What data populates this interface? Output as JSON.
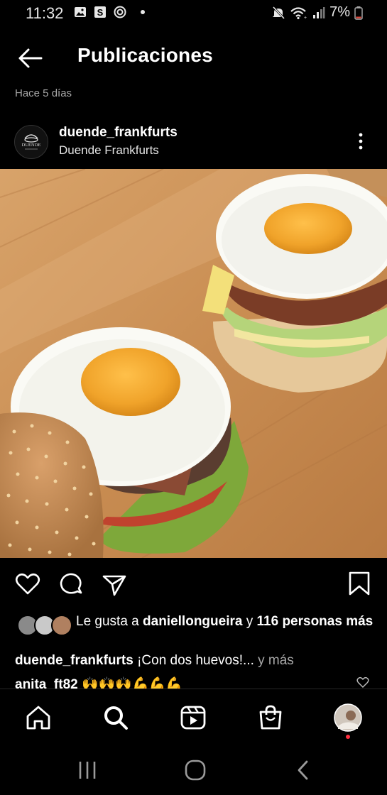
{
  "status_bar": {
    "time": "11:32",
    "battery": "7%",
    "left_icons": [
      "image-icon",
      "s-app-icon",
      "vpn-icon",
      "dot-icon"
    ],
    "right_icons": [
      "mute-icon",
      "wifi-icon",
      "signal-icon",
      "battery-icon"
    ]
  },
  "header": {
    "title": "Publicaciones",
    "back_icon": "arrow-left-icon"
  },
  "post": {
    "age": "Hace 5 días",
    "username": "duende_frankfurts",
    "full_name": "Duende Frankfurts",
    "avatar_text": "DUENDE",
    "more_icon": "more-vertical-icon",
    "photo_description": "two burgers with fried eggs on a wooden board",
    "actions": [
      "heart-icon",
      "comment-icon",
      "share-icon",
      "bookmark-icon"
    ],
    "likes": {
      "prefix": "Le gusta a ",
      "user": "daniellongueira",
      "connector": " y ",
      "others": "116 personas más"
    },
    "caption": {
      "username": "duende_frankfurts",
      "text": " ¡Con dos huevos!...",
      "more": " y más"
    },
    "comment": {
      "username": "anita_ft82",
      "text": " 🙌🙌🙌💪💪💪"
    }
  },
  "bottom_nav": [
    "home-icon",
    "search-icon",
    "reels-icon",
    "shop-icon",
    "profile-avatar"
  ],
  "system_nav": [
    "recents-icon",
    "home-circle-icon",
    "back-chevron-icon"
  ],
  "colors": {
    "background": "#000000",
    "secondary_text": "#a8a8a8",
    "notification_dot": "#ff3040",
    "battery_low": "#e0483d"
  }
}
